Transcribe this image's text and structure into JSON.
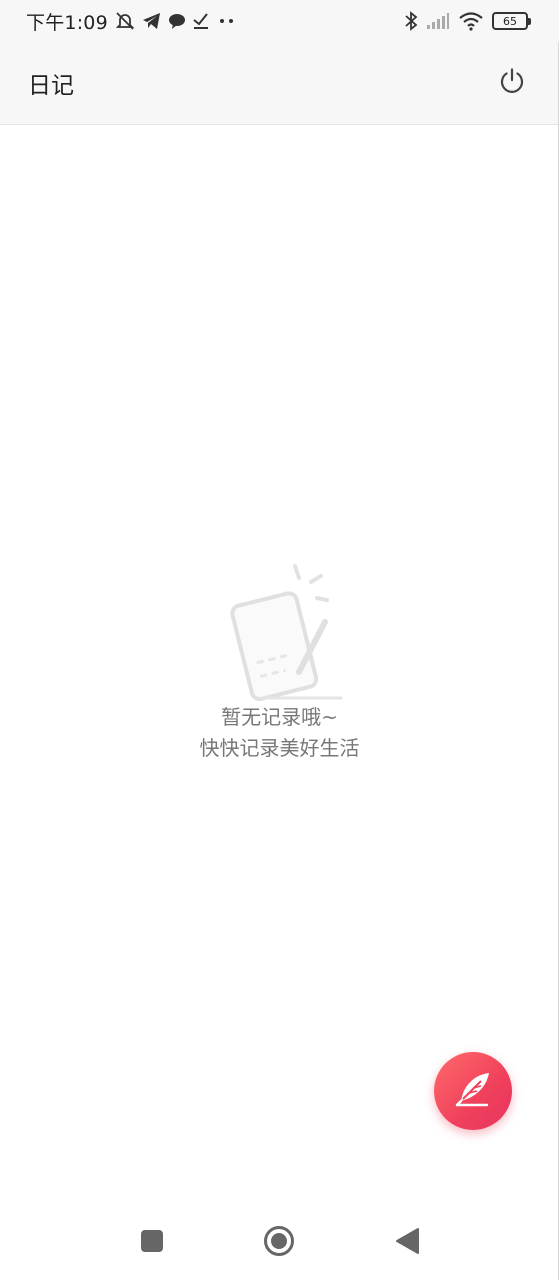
{
  "status_bar": {
    "time": "下午1:09",
    "battery": "65",
    "icons": [
      "muted-bell-icon",
      "telegram-icon",
      "chat-bubble-icon",
      "download-check-icon",
      "more-dots-icon",
      "bluetooth-icon",
      "signal-icon",
      "wifi-icon",
      "battery-icon"
    ]
  },
  "app_bar": {
    "title": "日记",
    "power_icon": "power-icon"
  },
  "empty_state": {
    "illustration": "notebook-pen-icon",
    "line1": "暂无记录哦~",
    "line2": "快快记录美好生活"
  },
  "fab": {
    "icon": "feather-quill-icon",
    "color": "#f0405c"
  },
  "nav_bar": {
    "items": [
      "recents-square-icon",
      "home-circle-icon",
      "back-triangle-icon"
    ]
  }
}
